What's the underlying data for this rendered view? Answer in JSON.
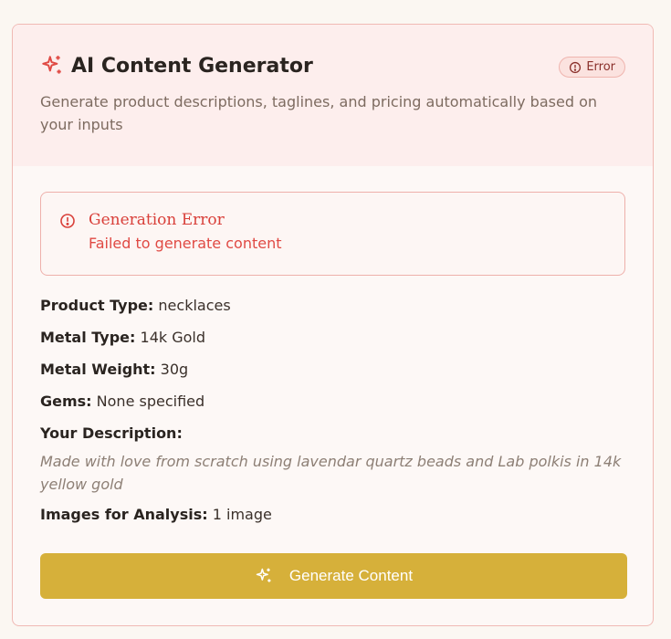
{
  "header": {
    "title": "AI Content Generator",
    "title_icon": "sparkles-icon",
    "badge": "Error",
    "badge_icon": "alert-circle-icon",
    "subtitle": "Generate product descriptions, taglines, and pricing automatically based on your inputs"
  },
  "error": {
    "icon": "alert-circle-icon",
    "title": "Generation Error",
    "message": "Failed to generate content"
  },
  "details": {
    "product_type_label": "Product Type:",
    "product_type_value": "necklaces",
    "metal_type_label": "Metal Type:",
    "metal_type_value": "14k Gold",
    "metal_weight_label": "Metal Weight:",
    "metal_weight_value": "30g",
    "gems_label": "Gems:",
    "gems_value": "None specified",
    "description_label": "Your Description:",
    "description_value": "Made with love from scratch using lavendar quartz beads and Lab polkis in 14k yellow gold",
    "images_label": "Images for Analysis:",
    "images_value": "1 image"
  },
  "button": {
    "label": "Generate Content",
    "icon": "sparkles-icon"
  },
  "colors": {
    "accent": "#d6b03a",
    "error": "#e04a44",
    "header_bg": "#fdeeed"
  }
}
